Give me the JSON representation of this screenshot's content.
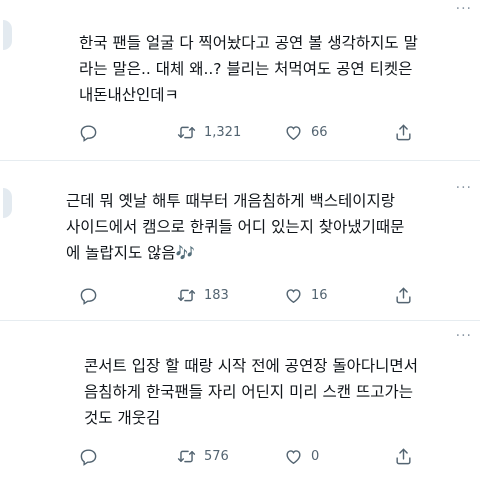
{
  "tweets": [
    {
      "text": "한국 팬들 얼굴 다 찍어놨다고 공연 볼 생각하지도 말\n라는 말은.. 대체 왜..? 블리는 처먹여도 공연 티켓은\n내돈내산인데ㅋ",
      "retweets": "1,321",
      "likes": "66"
    },
    {
      "text": "근데 뭐 옛날 해투 때부터 개음침하게 백스테이지랑\n사이드에서 캠으로 한퀴들 어디 있는지 찾아냈기때문\n에 놀랍지도 않음🎶",
      "retweets": "183",
      "likes": "16"
    },
    {
      "text": "콘서트 입장 할 때랑 시작 전에 공연장 돌아다니면서\n음침하게 한국팬들 자리 어딘지 미리 스캔 뜨고가는\n것도 개웃김",
      "retweets": "576",
      "likes": "0"
    }
  ],
  "icons": {
    "more": "more-options-icon",
    "reply": "reply-icon",
    "retweet": "retweet-icon",
    "like": "like-icon",
    "share": "share-icon"
  },
  "colors": {
    "text": "#0f1419",
    "muted": "#536471",
    "separator": "#e6ecf0"
  }
}
